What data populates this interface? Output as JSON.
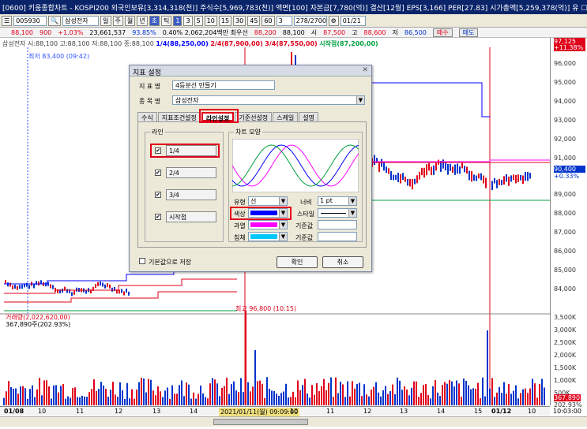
{
  "window": {
    "title": "[0600] 키움종합차트 - KOSPI200 외국인보유[3,314,318(천)] 주식수[5,969,783(천)] 액면[100] 자본금[7,780(억)] 결산[12월] EPS[3,166] PER[27.83] 시가총액[5,259,378(억)] 유 ☐ ◰ ☐ T ? ¦ ─ ☐ ✕"
  },
  "toolbar": {
    "symbol_code": "005930",
    "stock_name": "삼성전자",
    "period_buttons": [
      "일",
      "주",
      "월",
      "년"
    ],
    "selected_period": "초",
    "tick_label": "틱",
    "minute_values": [
      "1",
      "3",
      "5",
      "10",
      "15",
      "30",
      "45",
      "60"
    ],
    "selected_minute": "1",
    "count_value": "3",
    "bar_count": "278/2700",
    "date": "01/21"
  },
  "pricebar": {
    "price": "88,100",
    "change": "900",
    "change_pct": "+1.03%",
    "volume": "23,661,537",
    "vol_pct": "93.85%",
    "info": "0.40% 2,062,204백만 최우선",
    "bid": "88,200",
    "ask": "88,100",
    "open_label": "시",
    "open_value": "87,500",
    "high_label": "고",
    "high_value": "88,600",
    "low_label": "저",
    "low_value": "86,500",
    "buy_button": "매수",
    "sell_button": "매도"
  },
  "chart_legend": {
    "main": "삼성전자 시:88,100 고:88,100 저:88,100 종:88,100",
    "line1": "1/4(88,250,00)",
    "line2": "2/4(87,900,00)",
    "line3": "3/4(87,550,00)",
    "start": "시작점(87,200,00)",
    "min_label": "최저 83,400 (09:42)",
    "max_label": "최고 96,800 (10:15)",
    "volume_label": "거래량(2,022,620,00)",
    "volume_sub": "367,890주(202.93%)"
  },
  "price_axis": [
    "96,000",
    "95,000",
    "94,000",
    "93,000",
    "92,000",
    "91,000",
    "90,000",
    "89,000",
    "88,000",
    "87,000",
    "86,000",
    "85,000",
    "84,000"
  ],
  "price_axis_highlight": [
    "97,125",
    "+11.38%"
  ],
  "price_axis_current": [
    "90,400",
    "+0.33%"
  ],
  "volume_axis": [
    "3,500K",
    "3,000K",
    "2,500K",
    "2,000K",
    "1,500K",
    "1,000K",
    "500K"
  ],
  "volume_axis_current": [
    "367,890",
    "202.93%"
  ],
  "x_axis": [
    "01/08",
    "10",
    "11",
    "12",
    "13",
    "14",
    "2021/01/11(월) 09:09:00",
    "10",
    "11",
    "12",
    "13",
    "14",
    "15",
    "01/12",
    "10",
    "10:03:00"
  ],
  "dialog": {
    "title": "지표 설정",
    "name_label": "지 표 명",
    "name_value": "4등분선 만들기",
    "item_label": "종 목 명",
    "item_value": "삼성전자",
    "tabs": [
      "수식",
      "지표조건설정",
      "라인설정",
      "기준선설정",
      "스케일",
      "설명"
    ],
    "active_tab": "라인설정",
    "line_group": "라인",
    "lines": [
      {
        "label": "1/4",
        "checked": true
      },
      {
        "label": "2/4",
        "checked": true
      },
      {
        "label": "3/4",
        "checked": true
      },
      {
        "label": "시작점",
        "checked": true
      }
    ],
    "chart_group": "차트 모양",
    "type_label": "유형",
    "type_value": "선",
    "width_label": "너비",
    "width_value": "1 pt",
    "color_label": "색상",
    "style_label": "스타일",
    "over_label": "과열",
    "base1_label": "기준값",
    "under_label": "침체",
    "base2_label": "기준값",
    "save_default": "기본값으로 저장",
    "ok_button": "확인",
    "cancel_button": "취소",
    "colors": {
      "line": "#0000ff",
      "over": "#ff00ff",
      "under": "#00c8ff"
    }
  }
}
